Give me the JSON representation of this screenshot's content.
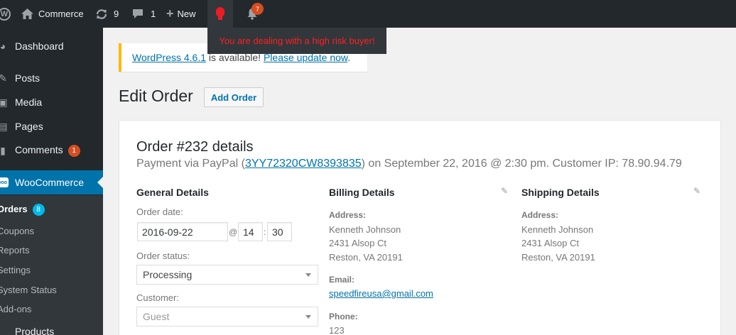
{
  "admin_bar": {
    "site_name": "Commerce",
    "updates_count": "9",
    "comments_count": "1",
    "new_label": "New",
    "notifications_count": "7",
    "risk_message": "You are dealing with a high risk buyer!",
    "risk_color": "#ff2020"
  },
  "sidebar": {
    "dashboard": "Dashboard",
    "posts": "Posts",
    "media": "Media",
    "pages": "Pages",
    "comments": "Comments",
    "comments_badge": "1",
    "woocommerce": "WooCommerce",
    "submenu": {
      "orders": "Orders",
      "orders_badge": "8",
      "coupons": "Coupons",
      "reports": "Reports",
      "settings": "Settings",
      "system_status": "System Status",
      "addons": "Add-ons"
    },
    "products_partial": "Products"
  },
  "notice": {
    "version_link": "WordPress 4.6.1",
    "middle_text": " is available! ",
    "update_link": "Please update now",
    "end_text": "."
  },
  "page": {
    "title": "Edit Order",
    "add_button": "Add Order"
  },
  "order": {
    "heading": "Order #232 details",
    "meta_prefix": "Payment via PayPal (",
    "transaction_id": "3YY72320CW8393835",
    "meta_suffix": ") on September 22, 2016 @ 2:30 pm. Customer IP: 78.90.94.79",
    "general": {
      "heading": "General Details",
      "date_label": "Order date:",
      "date_value": "2016-09-22",
      "at_symbol": "@",
      "hour": "14",
      "colon": ":",
      "minute": "30",
      "status_label": "Order status:",
      "status_value": "Processing",
      "customer_label": "Customer:",
      "customer_value": "Guest"
    },
    "billing": {
      "heading": "Billing Details",
      "address_label": "Address:",
      "address_lines": [
        "Kenneth Johnson",
        "2431 Alsop Ct",
        "Reston, VA 20191"
      ],
      "email_label": "Email:",
      "email": "speedfireusa@gmail.com",
      "phone_label": "Phone:",
      "phone": "123"
    },
    "shipping": {
      "heading": "Shipping Details",
      "address_label": "Address:",
      "address_lines": [
        "Kenneth Johnson",
        "2431 Alsop Ct",
        "Reston, VA 20191"
      ]
    }
  },
  "colors": {
    "admin_bar": "#23282d",
    "accent": "#0073aa",
    "notice_border": "#ffb900",
    "badge_orange": "#d54e21",
    "badge_blue": "#00b9eb"
  }
}
